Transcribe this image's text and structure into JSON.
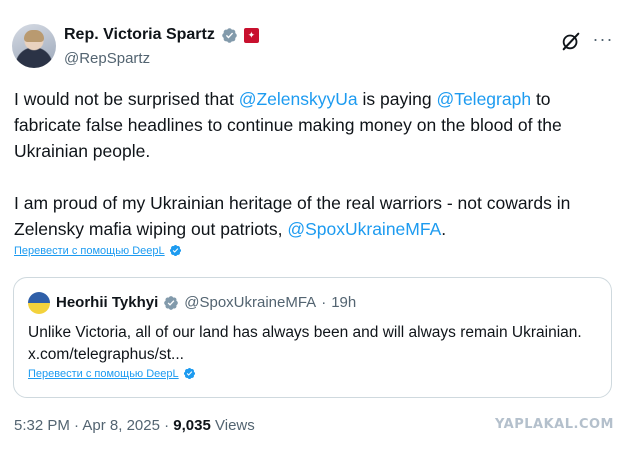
{
  "author": {
    "display_name": "Rep. Victoria Spartz",
    "handle": "@RepSpartz",
    "badge_icon": "verified-badge-icon",
    "flag_icon": "flag-badge-icon"
  },
  "actions": {
    "grok_icon": "grok-icon",
    "more_label": "···"
  },
  "tweet": {
    "p1_part1": "I would not be surprised that ",
    "p1_mention1": "@ZelenskyyUa",
    "p1_part2": " is paying ",
    "p1_mention2": "@Telegraph",
    "p1_part3": " to fabricate false headlines to continue making money on the blood of the Ukrainian people.",
    "p2_part1": "I am proud of my Ukrainian heritage of the real warriors - not cowards in Zelensky mafia wiping out patriots, ",
    "p2_mention": "@SpoxUkraineMFA",
    "p2_part2": "."
  },
  "translate_label": "Перевести с помощью DeepL",
  "quote": {
    "name": "Heorhii Tykhyi",
    "handle": "@SpoxUkraineMFA",
    "separator": "·",
    "time": "19h",
    "text": "Unlike Victoria, all of our land has always been and will always remain Ukrainian. x.com/telegraphus/st...",
    "translate_label": "Перевести с помощью DeepL"
  },
  "meta": {
    "time": "5:32 PM",
    "sep1": " · ",
    "date": "Apr 8, 2025",
    "sep2": " · ",
    "views_count": "9,035",
    "views_label": " Views"
  },
  "watermark": "YAPLAKAL.COM",
  "colors": {
    "link": "#1d9bf0",
    "text": "#0f1419",
    "secondary": "#536471",
    "border": "#cfd9de"
  }
}
